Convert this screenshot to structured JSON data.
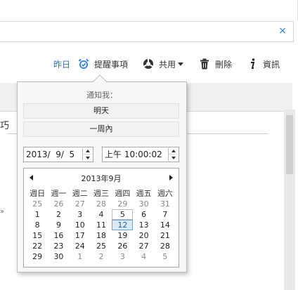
{
  "search": {
    "value": "",
    "placeholder": "",
    "clear_glyph": "×"
  },
  "toolbar": {
    "yesterday": "昨日",
    "reminder": "提醒事項",
    "share": "共用",
    "delete": "刪除",
    "info": "資訊"
  },
  "document": {
    "tab_text": "巧",
    "bullet": "»"
  },
  "popup": {
    "notify_label": "通知我：",
    "tomorrow": "明天",
    "one_week": "一周內",
    "date_value": "2013/  9/  5",
    "time_value": "上午 10:00:02"
  },
  "calendar": {
    "title": "2013年9月",
    "weekdays": [
      "週日",
      "週一",
      "週二",
      "週三",
      "週四",
      "週五",
      "週六"
    ],
    "rows": [
      [
        "25",
        "26",
        "27",
        "28",
        "29",
        "30",
        "31"
      ],
      [
        "1",
        "2",
        "3",
        "4",
        "5",
        "6",
        "7"
      ],
      [
        "8",
        "9",
        "10",
        "11",
        "12",
        "13",
        "14"
      ],
      [
        "15",
        "16",
        "17",
        "18",
        "19",
        "20",
        "21"
      ],
      [
        "22",
        "23",
        "24",
        "25",
        "26",
        "27",
        "28"
      ],
      [
        "29",
        "30",
        "1",
        "2",
        "3",
        "4",
        "5"
      ]
    ],
    "today": "5",
    "selected": "12"
  },
  "colors": {
    "accent": "#2a7fd4",
    "link": "#2a6fc7",
    "selected_bg": "#dbeaf7",
    "selected_border": "#6aa7d8"
  }
}
